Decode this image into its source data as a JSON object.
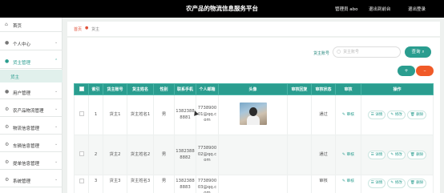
{
  "header": {
    "title": "农产品的物流信息服务平台",
    "user": "管理员 abo",
    "back_label": "退出到前台",
    "logout_label": "退出登录"
  },
  "sidebar": {
    "items": [
      {
        "label": "首页",
        "icon": "home-icon"
      },
      {
        "label": "个人中心",
        "icon": "user-icon"
      },
      {
        "label": "货主管理",
        "icon": "user-icon"
      },
      {
        "label": "用户管理",
        "icon": "user-icon"
      },
      {
        "label": "农产品物流管理",
        "icon": "gear-icon"
      },
      {
        "label": "物流信息管理",
        "icon": "gear-icon"
      },
      {
        "label": "车辆信息管理",
        "icon": "gear-icon"
      },
      {
        "label": "提单信息管理",
        "icon": "gear-icon"
      },
      {
        "label": "系统管理",
        "icon": "gear-icon"
      }
    ],
    "sub_item": "货主",
    "accent": "#2a9d8f"
  },
  "breadcrumb": {
    "home": "首页",
    "current": "货主"
  },
  "search": {
    "label": "货主账号",
    "placeholder": "货主账号",
    "button": "查询"
  },
  "toolbar": {
    "add": "+",
    "delete": "–"
  },
  "table": {
    "headers": [
      "",
      "索引",
      "货主账号",
      "货主姓名",
      "性别",
      "联系手机",
      "个人邮箱",
      "头像",
      "审核回复",
      "审核状态",
      "审核",
      "操作"
    ],
    "review_label": "审核",
    "actions": [
      "详情",
      "修改",
      "删除"
    ],
    "rows": [
      {
        "index": "1",
        "account": "货主1",
        "name": "货主姓名1",
        "gender": "男",
        "phone": "13823888881",
        "email": "773890001@qq.com",
        "reply": "",
        "status": "通过"
      },
      {
        "index": "2",
        "account": "货主2",
        "name": "货主姓名2",
        "gender": "男",
        "phone": "13823888882",
        "email": "773890002@qq.com",
        "reply": "",
        "status": "通过"
      },
      {
        "index": "3",
        "account": "货主3",
        "name": "货主姓名3",
        "gender": "男",
        "phone": "13823888883",
        "email": "773890003@qq.com",
        "reply": "",
        "status": "审核"
      }
    ]
  },
  "colors": {
    "teal": "#2a9d8f",
    "orange": "#f05a28",
    "header_bg": "#000000"
  }
}
